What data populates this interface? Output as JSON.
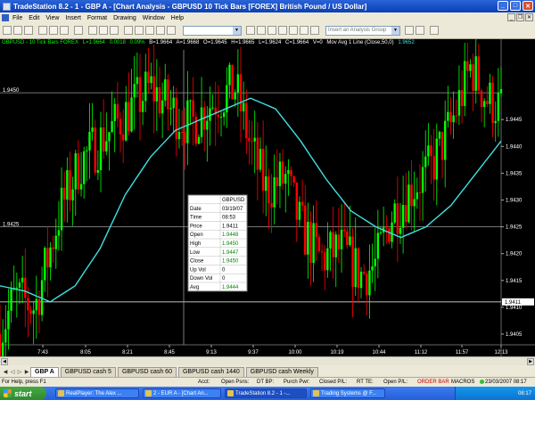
{
  "window": {
    "title": "TradeStation 8.2 - 1 - GBP A - [Chart Analysis - GBPUSD  10 Tick Bars [FOREX] British Pound / US Dollar]"
  },
  "menu": [
    "File",
    "Edit",
    "View",
    "Insert",
    "Format",
    "Drawing",
    "Window",
    "Help"
  ],
  "toolbar": {
    "analysis_placeholder": "Insert an Analysis Group"
  },
  "chart": {
    "header": {
      "symbol": "GBPUSD - 10 Tick Bars  FOREX",
      "last": "L=1.9664",
      "change": "0.0018",
      "change_pct": "0.09%",
      "bid": "B=1.9664",
      "ask": "A=1.9668",
      "open": "O=1.9645",
      "high": "H=1.9665",
      "low": "L=1.9624",
      "close": "C=1.9664",
      "volume": "V=0",
      "indicator": "Mov Avg 1 Line (Close,50,0)",
      "indicator_value": "1.9652"
    },
    "price_line_labels": {
      "upper": "1.9450",
      "lower": "1.9425"
    },
    "last_price_label": "1.9411",
    "axis_labels": [
      "1.9445",
      "1.9440",
      "1.9435",
      "1.9430",
      "1.9425",
      "1.9420",
      "1.9415",
      "1.9410",
      "1.9405"
    ],
    "time_labels": [
      "7:43",
      "8:05",
      "8:21",
      "8:45",
      "9:13",
      "9:37",
      "10:00",
      "10:19",
      "10:44",
      "11:12",
      "11:57",
      "12:13"
    ],
    "colors": {
      "up": "#00ff00",
      "down": "#ff0000",
      "ma": "#40e0e0",
      "grid": "#9a9a9a",
      "background": "#000000"
    },
    "data_window": {
      "title": "GBPUSD",
      "rows": [
        {
          "label": "Date",
          "value": "03/19/07"
        },
        {
          "label": "Time",
          "value": "08:53"
        },
        {
          "label": "Price",
          "value": "1.9411"
        },
        {
          "label": "Open",
          "value": "1.9448"
        },
        {
          "label": "High",
          "value": "1.9450"
        },
        {
          "label": "Low",
          "value": "1.9447"
        },
        {
          "label": "Close",
          "value": "1.9450"
        },
        {
          "label": "Up Vol",
          "value": "0"
        },
        {
          "label": "Down Vol",
          "value": "0"
        },
        {
          "label": "Avg",
          "value": "1.9444"
        }
      ]
    }
  },
  "chart_data": {
    "type": "candlestick",
    "price_axis": {
      "min": 1.9403,
      "max": 1.9458,
      "ticks": [
        1.9445,
        1.944,
        1.9435,
        1.943,
        1.9425,
        1.942,
        1.9415,
        1.941,
        1.9405
      ]
    },
    "reference_lines": [
      1.945,
      1.9425,
      1.9411
    ],
    "crosshair_time": "08:53",
    "moving_average_path": [
      [
        0,
        1.9414
      ],
      [
        0.05,
        1.9413
      ],
      [
        0.1,
        1.9411
      ],
      [
        0.15,
        1.9414
      ],
      [
        0.2,
        1.9421
      ],
      [
        0.25,
        1.9431
      ],
      [
        0.3,
        1.9438
      ],
      [
        0.35,
        1.9443
      ],
      [
        0.4,
        1.9445
      ],
      [
        0.45,
        1.9447
      ],
      [
        0.5,
        1.9449
      ],
      [
        0.55,
        1.9447
      ],
      [
        0.6,
        1.9441
      ],
      [
        0.65,
        1.9434
      ],
      [
        0.7,
        1.9428
      ],
      [
        0.75,
        1.9425
      ],
      [
        0.8,
        1.9423
      ],
      [
        0.85,
        1.9425
      ],
      [
        0.9,
        1.9429
      ],
      [
        0.95,
        1.9435
      ],
      [
        1.0,
        1.9441
      ]
    ],
    "price_path": [
      [
        0,
        1.9405
      ],
      [
        0.03,
        1.9412
      ],
      [
        0.07,
        1.941
      ],
      [
        0.12,
        1.9428
      ],
      [
        0.16,
        1.9437
      ],
      [
        0.2,
        1.9441
      ],
      [
        0.25,
        1.9446
      ],
      [
        0.3,
        1.9451
      ],
      [
        0.34,
        1.9447
      ],
      [
        0.38,
        1.9444
      ],
      [
        0.42,
        1.9448
      ],
      [
        0.47,
        1.9451
      ],
      [
        0.5,
        1.944
      ],
      [
        0.53,
        1.9432
      ],
      [
        0.57,
        1.9434
      ],
      [
        0.6,
        1.9425
      ],
      [
        0.64,
        1.9419
      ],
      [
        0.68,
        1.9421
      ],
      [
        0.72,
        1.9416
      ],
      [
        0.75,
        1.9418
      ],
      [
        0.78,
        1.9427
      ],
      [
        0.82,
        1.9432
      ],
      [
        0.86,
        1.9436
      ],
      [
        0.9,
        1.9444
      ],
      [
        0.94,
        1.9455
      ],
      [
        0.97,
        1.9449
      ],
      [
        1.0,
        1.9447
      ]
    ]
  },
  "tabs": [
    "GBP A",
    "GBPUSD cash 5",
    "GBPUSD cash 60",
    "GBPUSD cash 1440",
    "GBPUSD cash Weekly"
  ],
  "status": {
    "help": "For Help, press F1",
    "acct": "Acct:",
    "open_psns": "Open Psns:",
    "dt_bp": "DT BP:",
    "purch_pwr": "Purch Pwr:",
    "closed_pl": "Closed P/L:",
    "rt_te": "RT TE:",
    "open_pl": "Open P/L:",
    "order_bar": "ORDER BAR",
    "macros": "MACROS",
    "datetime": "23/03/2007 08:17"
  },
  "taskbar": {
    "start": "start",
    "tasks": [
      "RealPlayer: The Alex ...",
      "2 - EUR A - [Chart An...",
      "TradeStation 8.2 - 1 -...",
      "Trading Systems @ F..."
    ],
    "lang": "EN",
    "clock": "08:17"
  }
}
